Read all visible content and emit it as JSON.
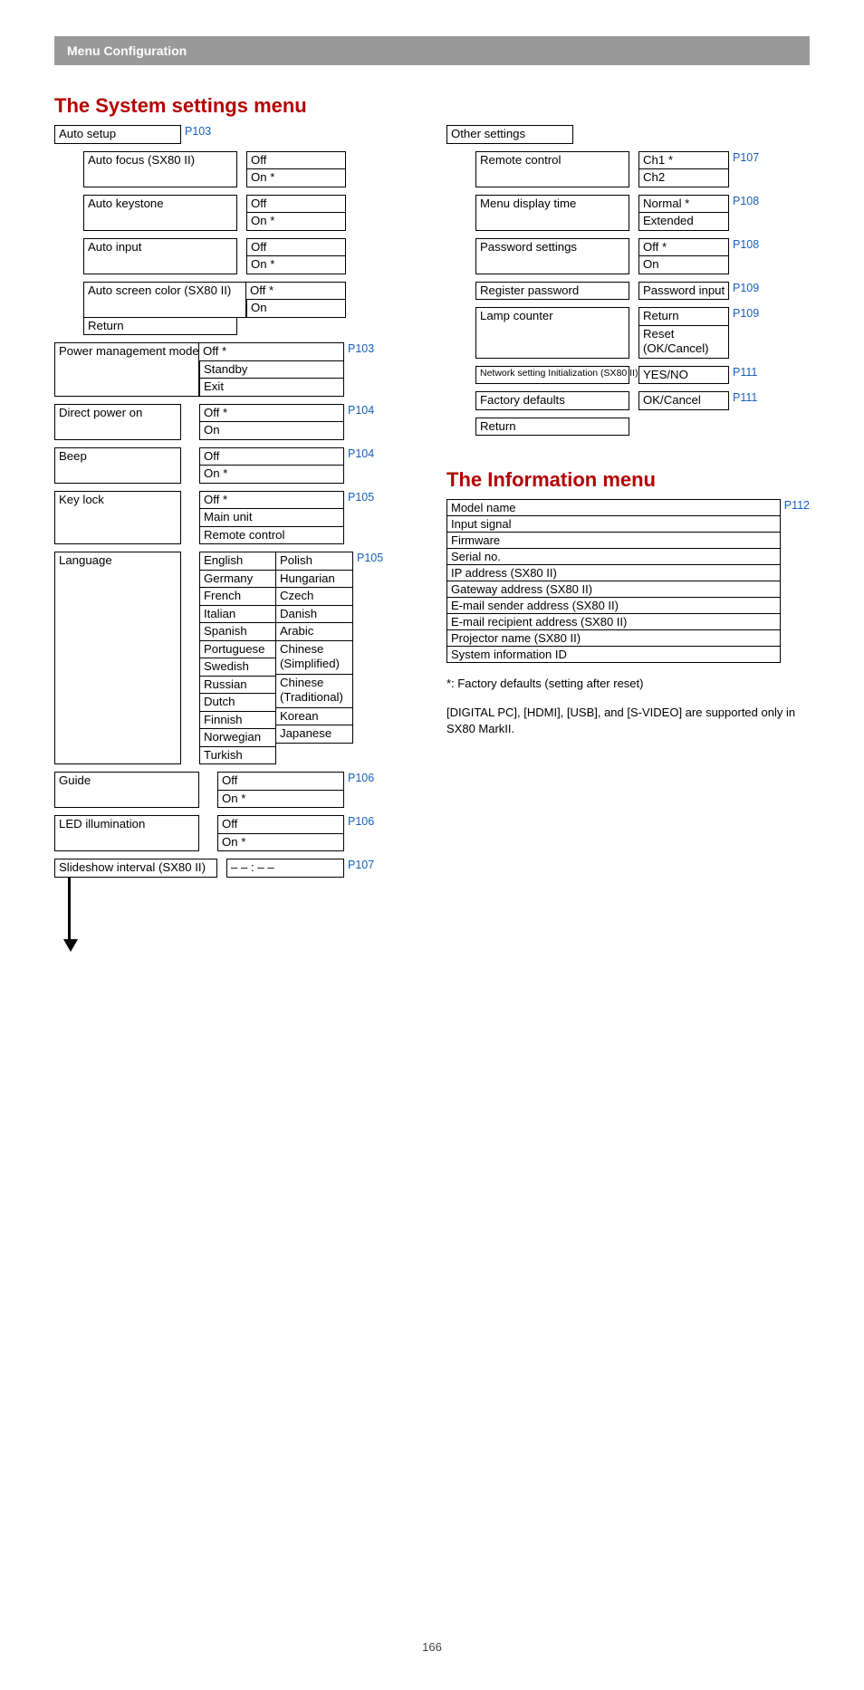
{
  "header": "Menu Configuration",
  "title1": "The System settings menu",
  "title2": "The Information menu",
  "page_number": "166",
  "auto_setup": {
    "label": "Auto setup",
    "link": "P103",
    "auto_focus": {
      "label": "Auto focus (SX80 II)",
      "opts": [
        "Off",
        "On *"
      ]
    },
    "auto_keystone": {
      "label": "Auto keystone",
      "opts": [
        "Off",
        "On *"
      ]
    },
    "auto_input": {
      "label": "Auto input",
      "opts": [
        "Off",
        "On *"
      ]
    },
    "auto_screen_color": {
      "label": "Auto screen color (SX80 II)",
      "opts": [
        "Off *",
        "On"
      ]
    },
    "return": "Return"
  },
  "power_mgmt": {
    "label": "Power management mode",
    "opts": [
      "Off *",
      "Standby",
      "Exit"
    ],
    "link": "P103"
  },
  "direct_power": {
    "label": "Direct power on",
    "opts": [
      "Off *",
      "On"
    ],
    "link": "P104"
  },
  "beep": {
    "label": "Beep",
    "opts": [
      "Off",
      "On *"
    ],
    "link": "P104"
  },
  "key_lock": {
    "label": "Key lock",
    "opts": [
      "Off *",
      "Main unit",
      "Remote control"
    ],
    "link": "P105"
  },
  "language": {
    "label": "Language",
    "link": "P105",
    "col1": [
      "English",
      "Germany",
      "French",
      "Italian",
      "Spanish",
      "Portuguese",
      "Swedish",
      "Russian",
      "Dutch",
      "Finnish",
      "Norwegian",
      "Turkish"
    ],
    "col2": [
      "Polish",
      "Hungarian",
      "Czech",
      "Danish",
      "Arabic",
      "Chinese (Simplified)",
      "Chinese (Traditional)",
      "Korean",
      "Japanese"
    ]
  },
  "guide": {
    "label": "Guide",
    "opts": [
      "Off",
      "On *"
    ],
    "link": "P106"
  },
  "led": {
    "label": "LED illumination",
    "opts": [
      "Off",
      "On *"
    ],
    "link": "P106"
  },
  "slideshow": {
    "label": "Slideshow interval (SX80 II)",
    "val": "– – : – –",
    "link": "P107"
  },
  "other": {
    "label": "Other settings",
    "remote": {
      "label": "Remote control",
      "opts": [
        "Ch1 *",
        "Ch2"
      ],
      "link": "P107"
    },
    "menu_time": {
      "label": "Menu display time",
      "opts": [
        "Normal *",
        "Extended"
      ],
      "link": "P108"
    },
    "password": {
      "label": "Password settings",
      "opts": [
        "Off *",
        "On"
      ],
      "link": "P108"
    },
    "register_pw": {
      "label": "Register password",
      "val": "Password input",
      "link": "P109"
    },
    "lamp": {
      "label": "Lamp counter",
      "opts": [
        "Return",
        "Reset (OK/Cancel)"
      ],
      "link": "P109"
    },
    "net_init": {
      "label": "Network setting Initialization (SX80 II)",
      "val": "YES/NO",
      "link": "P111"
    },
    "factory": {
      "label": "Factory defaults",
      "val": "OK/Cancel",
      "link": "P111"
    },
    "return": "Return"
  },
  "info": {
    "rows": [
      "Model name",
      "Input signal",
      "Firmware",
      "Serial no.",
      "IP address (SX80 II)",
      "Gateway address (SX80 II)",
      "E-mail sender address (SX80 II)",
      "E-mail recipient address (SX80 II)",
      "Projector name (SX80 II)",
      "System information ID"
    ],
    "link": "P112"
  },
  "footnote1": "*: Factory defaults (setting after reset)",
  "footnote2": "[DIGITAL PC], [HDMI], [USB], and [S-VIDEO] are supported only in SX80 MarkII."
}
